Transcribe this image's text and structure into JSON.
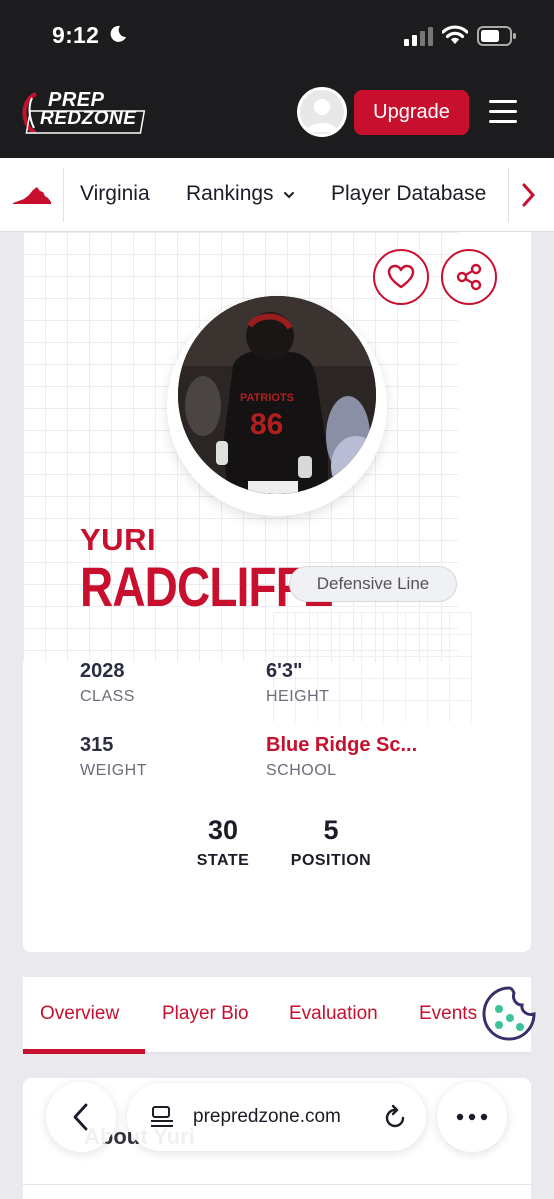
{
  "status_bar": {
    "time": "9:12"
  },
  "header": {
    "logo_line1": "PREP",
    "logo_line2": "REDZONE",
    "upgrade_label": "Upgrade"
  },
  "subnav": {
    "state": "Virginia",
    "rankings": "Rankings",
    "player_database": "Player Database"
  },
  "player": {
    "first_name": "YURI",
    "last_name": "RADCLIFFE",
    "position": "Defensive Line",
    "stats": {
      "class_value": "2028",
      "class_label": "CLASS",
      "height_value": "6'3\"",
      "height_label": "HEIGHT",
      "weight_value": "315",
      "weight_label": "WEIGHT",
      "school_value": "Blue Ridge Sc...",
      "school_label": "SCHOOL"
    },
    "ranks": {
      "state_value": "30",
      "state_label": "STATE",
      "position_value": "5",
      "position_label": "POSITION"
    }
  },
  "tabs": [
    "Overview",
    "Player Bio",
    "Evaluation",
    "Events"
  ],
  "about": {
    "title": "About Yuri"
  },
  "browser": {
    "url": "prepredzone.com"
  },
  "colors": {
    "brand_red": "#c8102e",
    "header_bg": "#1c1c1e"
  }
}
